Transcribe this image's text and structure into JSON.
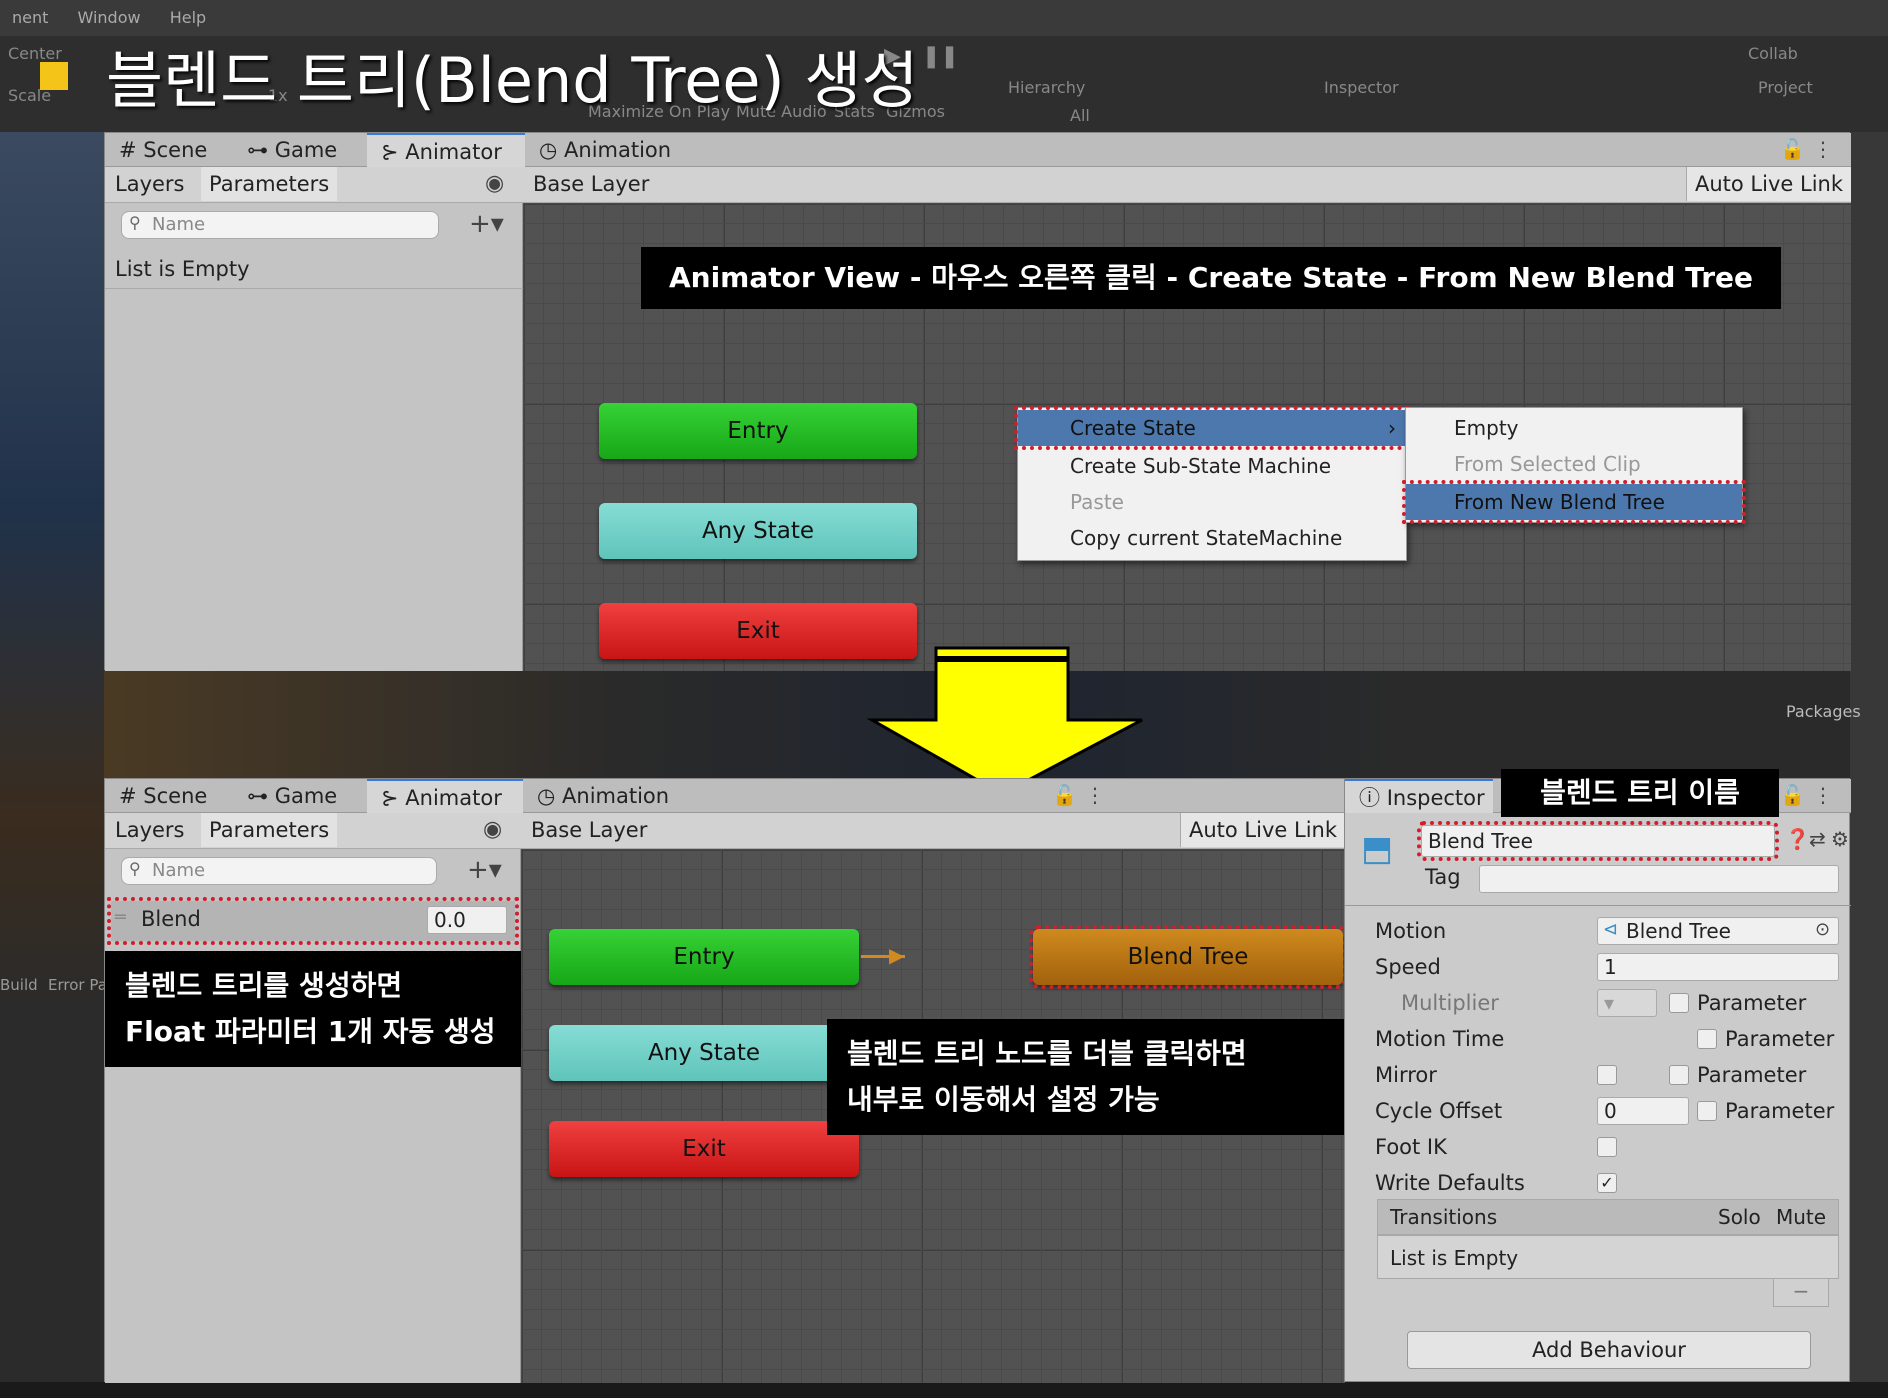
{
  "window": {
    "menu": [
      "nent",
      "Window",
      "Help"
    ],
    "toolbar": {
      "center": "Center",
      "collab": "Collab",
      "hierarchy_tab": "Hierarchy",
      "inspector_tab": "Inspector",
      "project_tab": "Project",
      "scale_label": "Scale",
      "scale_value": "1x",
      "game_options": [
        "Maximize On Play",
        "Mute Audio",
        "Stats",
        "Gizmos"
      ],
      "hierarchy_search": "All",
      "packages": "Packages",
      "build": "Build",
      "error_pause": "Error Pa"
    }
  },
  "slide": {
    "title": "블렌드 트리(Blend Tree) 생성"
  },
  "top_panel": {
    "tabs": [
      "Scene",
      "Game",
      "Animator",
      "Animation"
    ],
    "layers_label": "Layers",
    "parameters_label": "Parameters",
    "search_placeholder": "Name",
    "list_empty": "List is Empty",
    "base_layer": "Base Layer",
    "auto_live_link": "Auto Live Link",
    "caption": "Animator View - 마우스 오른쪽 클릭 - Create State - From New Blend Tree",
    "nodes": {
      "entry": "Entry",
      "any_state": "Any State",
      "exit": "Exit"
    },
    "context_menu": [
      "Create State",
      "Create Sub-State Machine",
      "Paste",
      "Copy current StateMachine"
    ],
    "submenu": [
      "Empty",
      "From Selected Clip",
      "From New Blend Tree"
    ]
  },
  "bottom_panel": {
    "tabs": [
      "Scene",
      "Game",
      "Animator",
      "Animation"
    ],
    "layers_label": "Layers",
    "parameters_label": "Parameters",
    "search_placeholder": "Name",
    "parameter": {
      "name": "Blend",
      "value": "0.0"
    },
    "caption_left_line1": "블렌드 트리를 생성하면",
    "caption_left_line2": "Float 파라미터 1개 자동 생성",
    "base_layer": "Base Layer",
    "auto_live_link": "Auto Live Link",
    "nodes": {
      "entry": "Entry",
      "any_state": "Any State",
      "exit": "Exit",
      "blend_tree": "Blend Tree"
    },
    "caption_center_line1": "블렌드 트리 노드를 더블 클릭하면",
    "caption_center_line2": "내부로 이동해서 설정 가능"
  },
  "inspector": {
    "tab": "Inspector",
    "name_caption": "블렌드 트리 이름",
    "name_value": "Blend Tree",
    "tag_label": "Tag",
    "motion_label": "Motion",
    "motion_value": "Blend Tree",
    "speed_label": "Speed",
    "speed_value": "1",
    "multiplier_label": "Multiplier",
    "parameter_label": "Parameter",
    "motion_time_label": "Motion Time",
    "mirror_label": "Mirror",
    "cycle_offset_label": "Cycle Offset",
    "cycle_offset_value": "0",
    "foot_ik_label": "Foot IK",
    "write_defaults_label": "Write Defaults",
    "write_defaults_checked": "✓",
    "transitions_label": "Transitions",
    "solo_label": "Solo",
    "mute_label": "Mute",
    "transitions_empty": "List is Empty",
    "remove_symbol": "−",
    "add_behaviour": "Add Behaviour"
  },
  "colors": {
    "entry": "#17a717",
    "any_state": "#5fc4ba",
    "exit": "#c81414",
    "blend_tree": "#a2610c",
    "highlight_dots": "#d31c2c",
    "arrow": "#ffff00",
    "title_bullet": "#f4c418"
  }
}
